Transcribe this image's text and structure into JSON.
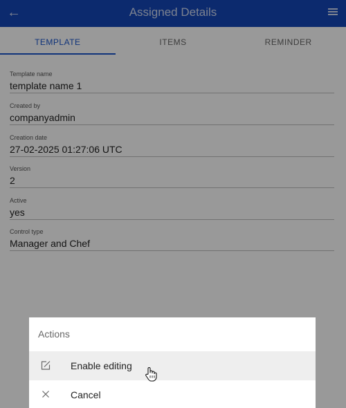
{
  "appbar": {
    "title": "Assigned Details",
    "back_icon": "arrow-left-icon",
    "menu_icon": "hamburger-menu-icon"
  },
  "tabs": [
    {
      "label": "TEMPLATE",
      "active": true
    },
    {
      "label": "ITEMS",
      "active": false
    },
    {
      "label": "REMINDER",
      "active": false
    }
  ],
  "fields": [
    {
      "label": "Template name",
      "value": "template name 1"
    },
    {
      "label": "Created by",
      "value": "companyadmin"
    },
    {
      "label": "Creation date",
      "value": "27-02-2025 01:27:06 UTC"
    },
    {
      "label": "Version",
      "value": "2"
    },
    {
      "label": "Active",
      "value": "yes"
    },
    {
      "label": "Control type",
      "value": "Manager and Chef"
    }
  ],
  "actions_sheet": {
    "title": "Actions",
    "items": [
      {
        "label": "Enable editing",
        "icon": "edit-icon",
        "hovered": true
      },
      {
        "label": "Cancel",
        "icon": "close-icon",
        "hovered": false
      }
    ]
  },
  "colors": {
    "appbar": "#1447b8",
    "accent": "#1b56cc"
  }
}
